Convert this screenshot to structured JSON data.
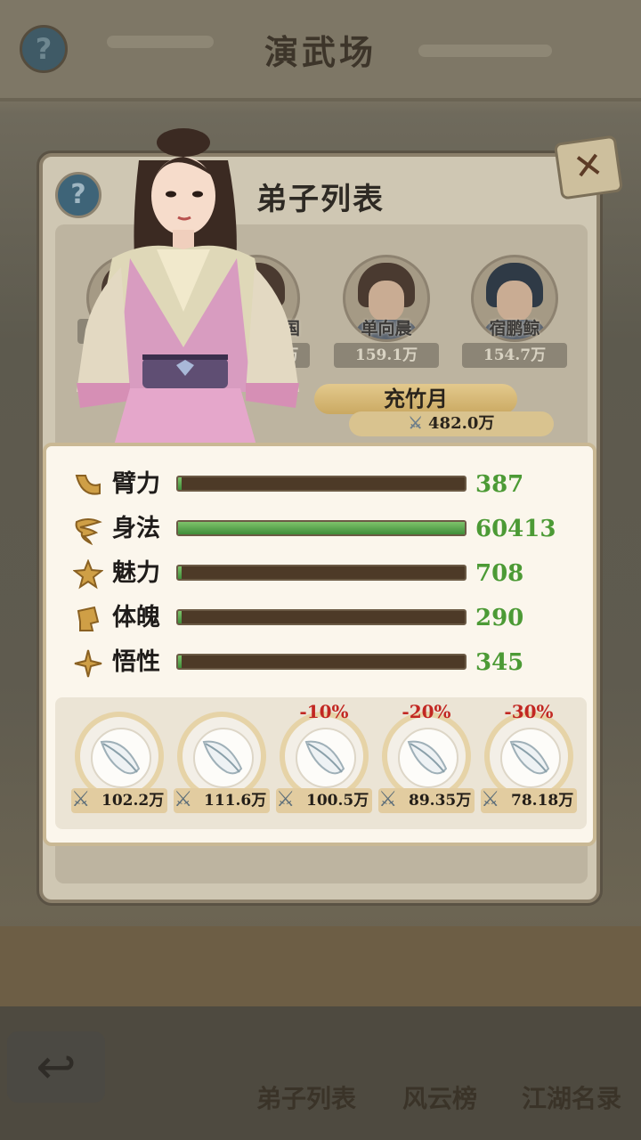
{
  "background": {
    "title": "演武场",
    "help_icon": "question-icon",
    "nav": [
      {
        "label": "弟子列表"
      },
      {
        "label": "风云榜"
      },
      {
        "label": "江湖名录"
      }
    ]
  },
  "modal": {
    "title": "弟子列表",
    "help_icon": "question-icon",
    "close_icon": "close-x-icon"
  },
  "disciples": [
    {
      "name": "",
      "power": ""
    },
    {
      "name": "志国",
      "power": ".8万"
    },
    {
      "name": "单向晨",
      "power": "159.1万"
    },
    {
      "name": "宿鹏鲸",
      "power": "154.7万"
    }
  ],
  "selected": {
    "name": "充竹月",
    "power": "482.0万"
  },
  "stats": [
    {
      "label": "臂力",
      "value": "387",
      "fill": 0.0064,
      "icon": "arm-icon"
    },
    {
      "label": "身法",
      "value": "60413",
      "fill": 1.0,
      "icon": "whirlwind-icon"
    },
    {
      "label": "魅力",
      "value": "708",
      "fill": 0.0117,
      "icon": "star-icon"
    },
    {
      "label": "体魄",
      "value": "290",
      "fill": 0.0048,
      "icon": "fist-icon"
    },
    {
      "label": "悟性",
      "value": "345",
      "fill": 0.0057,
      "icon": "sparkle-icon"
    }
  ],
  "items": [
    {
      "discount": "",
      "price": "102.2万",
      "icon": "feather-icon"
    },
    {
      "discount": "",
      "price": "111.6万",
      "icon": "feather-icon"
    },
    {
      "discount": "-10%",
      "price": "100.5万",
      "icon": "feather-icon"
    },
    {
      "discount": "-20%",
      "price": "89.35万",
      "icon": "feather-icon"
    },
    {
      "discount": "-30%",
      "price": "78.18万",
      "icon": "feather-icon"
    }
  ],
  "colors": {
    "stat_value": "#4c9a35",
    "discount": "#c22722",
    "stat_bar_track": "#4d3a27",
    "stat_bar_fill": "#5aa84a"
  }
}
